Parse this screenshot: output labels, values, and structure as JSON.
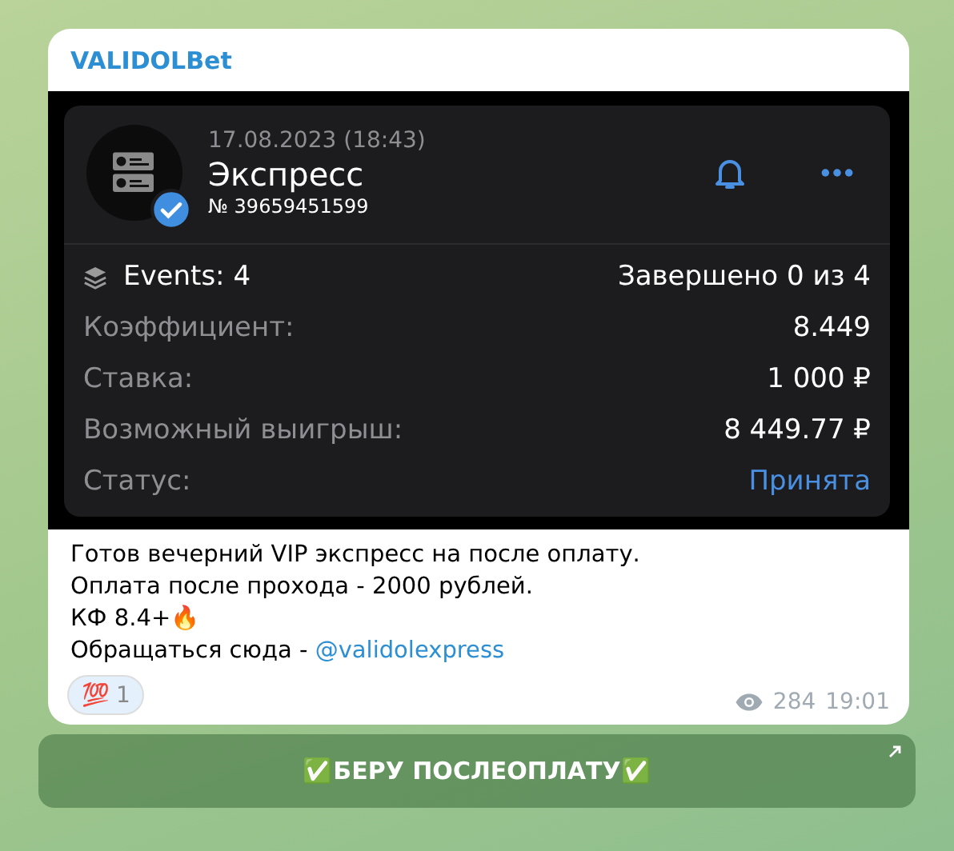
{
  "channel": {
    "name": "VALIDOLBet"
  },
  "bet_card": {
    "date": "17.08.2023 (18:43)",
    "title": "Экспресс",
    "number": "№ 39659451599",
    "verified": true,
    "events": {
      "label": "Events: 4",
      "progress": "Завершено 0 из 4"
    },
    "rows": [
      {
        "kind": "plain",
        "label": "Коэффициент:",
        "value": "8.449"
      },
      {
        "kind": "plain",
        "label": "Ставка:",
        "value": "1 000 ₽"
      },
      {
        "kind": "plain",
        "label": "Возможный выигрыш:",
        "value": "8 449.77 ₽"
      },
      {
        "kind": "status",
        "label": "Статус:",
        "value": "Принята"
      }
    ]
  },
  "message": {
    "lines": [
      {
        "text": "Готов вечерний VIP экспресс на после оплату."
      },
      {
        "text": "Оплата после прохода - 2000 рублей."
      },
      {
        "text": "КФ 8.4+🔥"
      },
      {
        "text": "Обращаться сюда - ",
        "link": "@validolexpress"
      }
    ]
  },
  "reactions": [
    {
      "emoji": "💯",
      "count": "1",
      "selected": true
    }
  ],
  "views": "284",
  "time": "19:01",
  "inline_button": {
    "label": "✅БЕРУ ПОСЛЕОПЛАТУ✅"
  }
}
